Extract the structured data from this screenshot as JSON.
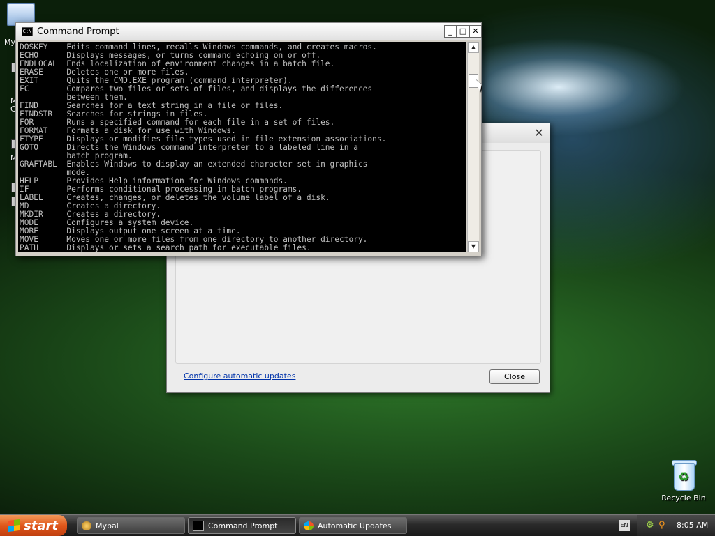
{
  "desktop": {
    "icons": [
      {
        "label": "My"
      },
      {
        "label": "Recycle Bin"
      }
    ],
    "side_fragments": [
      "M",
      "C",
      "M"
    ]
  },
  "auto_updates_window": {
    "link_text": "Configure automatic updates",
    "close_button": "Close"
  },
  "cmd_window": {
    "title": "Command Prompt",
    "lines": [
      "DOSKEY    Edits command lines, recalls Windows commands, and creates macros.",
      "ECHO      Displays messages, or turns command echoing on or off.",
      "ENDLOCAL  Ends localization of environment changes in a batch file.",
      "ERASE     Deletes one or more files.",
      "EXIT      Quits the CMD.EXE program (command interpreter).",
      "FC        Compares two files or sets of files, and displays the differences",
      "          between them.",
      "FIND      Searches for a text string in a file or files.",
      "FINDSTR   Searches for strings in files.",
      "FOR       Runs a specified command for each file in a set of files.",
      "FORMAT    Formats a disk for use with Windows.",
      "FTYPE     Displays or modifies file types used in file extension associations.",
      "GOTO      Directs the Windows command interpreter to a labeled line in a",
      "          batch program.",
      "GRAFTABL  Enables Windows to display an extended character set in graphics",
      "          mode.",
      "HELP      Provides Help information for Windows commands.",
      "IF        Performs conditional processing in batch programs.",
      "LABEL     Creates, changes, or deletes the volume label of a disk.",
      "MD        Creates a directory.",
      "MKDIR     Creates a directory.",
      "MODE      Configures a system device.",
      "MORE      Displays output one screen at a time.",
      "MOVE      Moves one or more files from one directory to another directory.",
      "PATH      Displays or sets a search path for executable files."
    ]
  },
  "taskbar": {
    "start_label": "start",
    "tasks": [
      {
        "label": "Mypal",
        "icon": "mypal-icon"
      },
      {
        "label": "Command Prompt",
        "icon": "cmd-icon",
        "active": true
      },
      {
        "label": "Automatic Updates",
        "icon": "windows-update-icon"
      }
    ],
    "language": "EN",
    "clock": "8:05 AM"
  }
}
